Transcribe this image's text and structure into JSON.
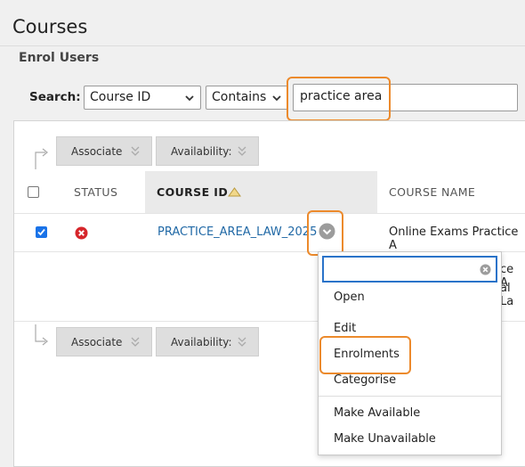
{
  "page": {
    "title": "Courses",
    "subtitle": "Enrol Users"
  },
  "search": {
    "label": "Search:",
    "field": "Course ID",
    "operator": "Contains",
    "value": "practice area"
  },
  "toolbar": {
    "associate": "Associate",
    "availability": "Availability:"
  },
  "table": {
    "columns": {
      "status": "STATUS",
      "course_id": "COURSE ID",
      "course_name": "COURSE NAME"
    },
    "rows": [
      {
        "checked": true,
        "status_icon": "unavailable-x-icon",
        "course_id": "PRACTICE_AREA_LAW_2025",
        "course_name": "Online Exams Practice A",
        "course_name_cont1": "ce A",
        "course_name_cont2": "al La"
      }
    ]
  },
  "context_menu": {
    "filter_value": "",
    "items": [
      "Open",
      "Edit",
      "Enrolments",
      "Categorise"
    ],
    "items2": [
      "Make Available",
      "Make Unavailable"
    ]
  },
  "colors": {
    "accent_highlight": "#ec8a2c",
    "link": "#2169a6",
    "checkbox": "#1a73e8",
    "status_red": "#d6262b"
  }
}
